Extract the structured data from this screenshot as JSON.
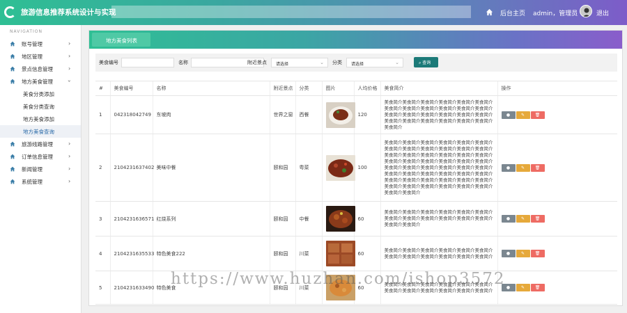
{
  "header": {
    "app_title": "旅游信息推荐系统设计与实现",
    "home_label": "后台主页",
    "user_label": "admin，管理员",
    "logout_label": "退出"
  },
  "sidebar": {
    "heading": "NAVIGATION",
    "items": [
      {
        "label": "账号管理"
      },
      {
        "label": "地区管理"
      },
      {
        "label": "景点信息管理"
      },
      {
        "label": "地方美食管理"
      }
    ],
    "sub_items": [
      {
        "label": "美食分类添加"
      },
      {
        "label": "美食分类查询"
      },
      {
        "label": "地方美食添加"
      },
      {
        "label": "地方美食查询"
      }
    ],
    "items_after": [
      {
        "label": "旅游线路管理"
      },
      {
        "label": "订单信息管理"
      },
      {
        "label": "新闻管理"
      },
      {
        "label": "系统管理"
      }
    ],
    "chevron": "›"
  },
  "main": {
    "tab_label": "地方美食列表",
    "filter": {
      "code_label": "美食编号",
      "name_label": "名称",
      "spot_label": "附近景点",
      "spot_value": "请选择",
      "category_label": "分类",
      "category_value": "请选择",
      "search_label": "查询"
    },
    "table": {
      "columns": [
        "#",
        "美食编号",
        "名称",
        "附近景点",
        "分类",
        "图片",
        "人均价格",
        "美食简介",
        "操作"
      ],
      "rows": [
        {
          "no": "1",
          "code": "0423180427­49",
          "name": "东坡肉",
          "spot": "世界之窗",
          "category": "西餐",
          "price": "120",
          "intro": "美食简介美食简介美食简介美食简介美食简介美食简介美食简介美食简介美食简介美食简介美食简介美食简介美食简介美食简介美食简介美食简介美食简介美食简介美食简介美食简介美食简介美食简介美食简介美食简介美食简介"
        },
        {
          "no": "2",
          "code": "2104231637402",
          "name": "美味中餐",
          "spot": "颐和园",
          "category": "粤菜",
          "price": "100",
          "intro": "美食简介美食简介美食简介美食简介美食简介美食简介美食简介美食简介美食简介美食简介美食简介美食简介美食简介美食简介美食简介美食简介美食简介美食简介美食简介美食简介美食简介美食简介美食简介美食简介美食简介美食简介美食简介美食简介美食简介美食简介美食简介美食简介美食简介美食简介美食简介美食简介美食简介美食简介美食简介美食简介美食简介美食简介美食简介美食简介美食简介美食简介美食简介美食简介美食简介美食简介"
        },
        {
          "no": "3",
          "code": "2104231636571",
          "name": "红烧系列",
          "spot": "颐和园",
          "category": "中餐",
          "price": "60",
          "intro": "美食简介美食简介美食简介美食简介美食简介美食简介美食简介美食简介美食简介美食简介美食简介美食简介美食简介美食简介"
        },
        {
          "no": "4",
          "code": "2104231635533",
          "name": "特色美食222",
          "spot": "颐和园",
          "category": "川菜",
          "price": "60",
          "intro": "美食简介美食简介美食简介美食简介美食简介美食简介美食简介美食简介美食简介美食简介美食简介美食简介"
        },
        {
          "no": "5",
          "code": "2104231633490",
          "name": "特色美食",
          "spot": "颐和园",
          "category": "川菜",
          "price": "60",
          "intro": "美食简介美食简介美食简介美食简介美食简介美食简介美食简介美食简介美食简介美食简介美食简介美食简介"
        }
      ],
      "actions": {
        "view": "●",
        "edit": "✎",
        "delete": "🗑"
      }
    }
  },
  "watermark": "https://www.huzhan.com/ishop3572",
  "colors": {
    "accent": "#1c7a78",
    "view": "#7b8790",
    "edit": "#e6a93b",
    "delete": "#ee6b63"
  }
}
